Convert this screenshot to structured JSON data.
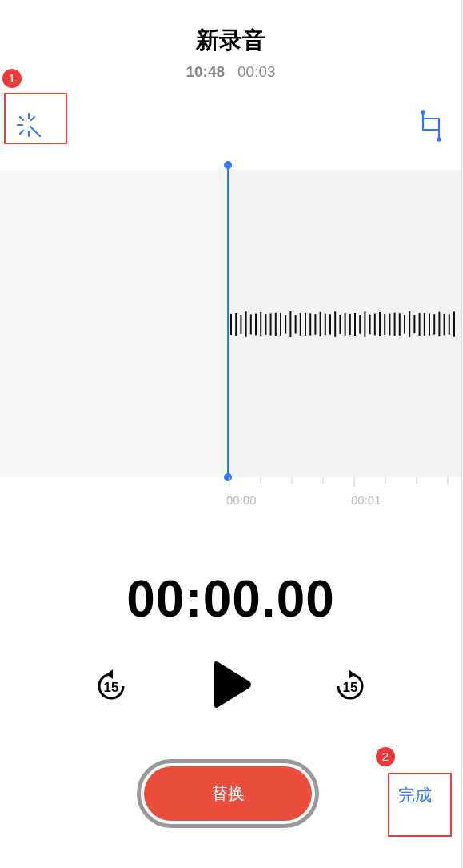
{
  "header": {
    "title": "新录音",
    "time": "10:48",
    "duration": "00:03"
  },
  "timeline": {
    "ticks": [
      "00:00",
      "00:01"
    ]
  },
  "timer": "00:00.00",
  "controls": {
    "skip_back": "15",
    "skip_forward": "15"
  },
  "buttons": {
    "replace": "替换",
    "done": "完成"
  },
  "annotations": [
    {
      "label": "1"
    },
    {
      "label": "2"
    }
  ]
}
